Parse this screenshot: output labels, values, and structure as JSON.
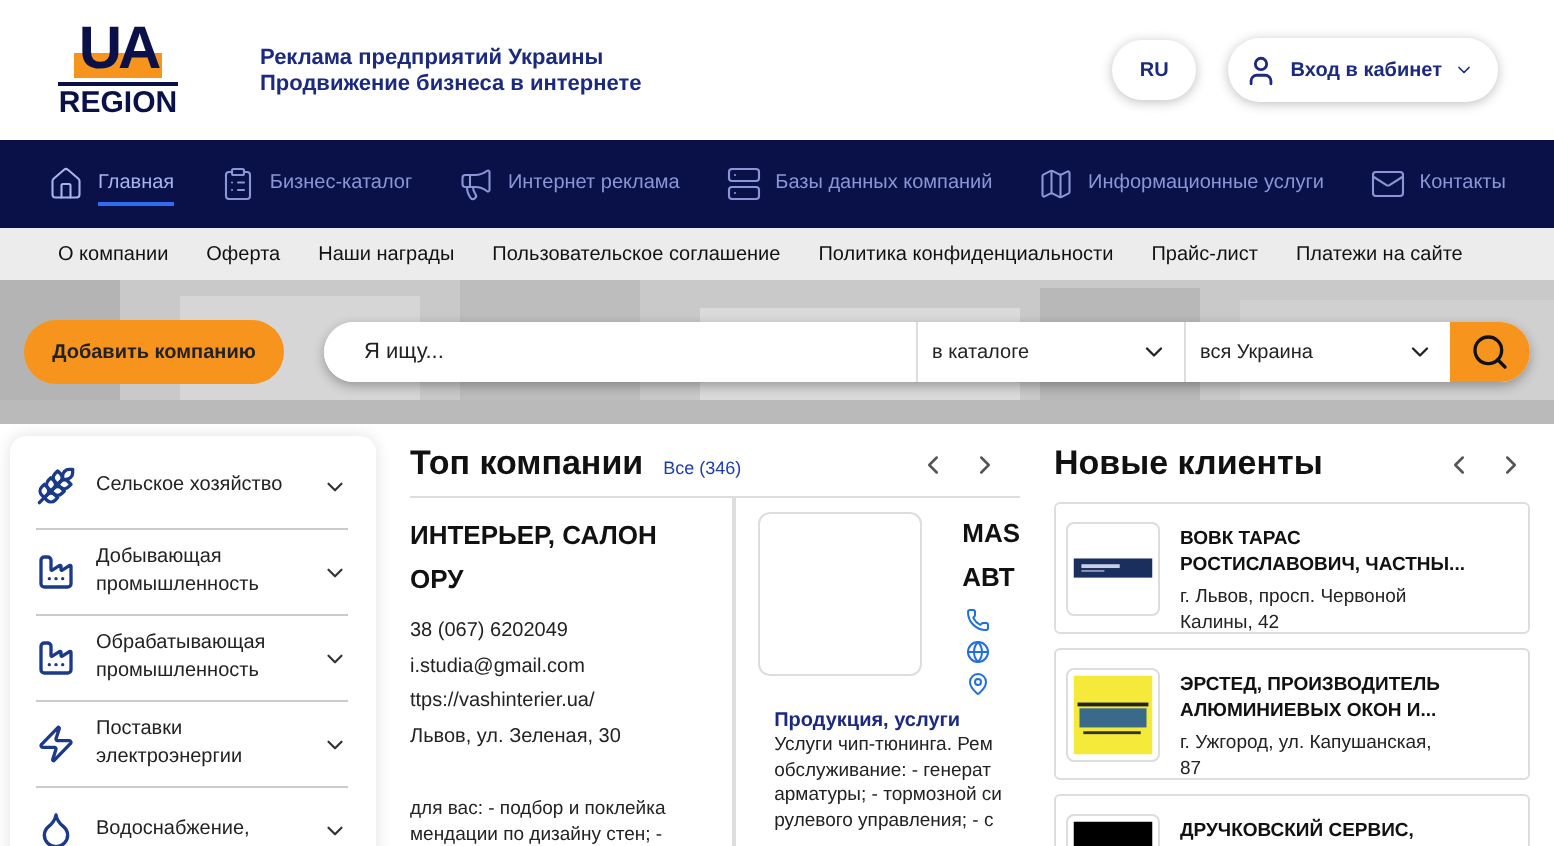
{
  "logo": {
    "top": "UA",
    "bottom": "REGION"
  },
  "tagline": [
    "Реклама предприятий Украины",
    "Продвижение бизнеса в интернете"
  ],
  "language_button": "RU",
  "login_button": "Вход в кабинет",
  "nav": [
    {
      "label": "Главная",
      "selected": true
    },
    {
      "label": "Бизнес-каталог",
      "selected": false
    },
    {
      "label": "Интернет реклама",
      "selected": false
    },
    {
      "label": "Базы данных компаний",
      "selected": false
    },
    {
      "label": "Информационные услуги",
      "selected": false
    },
    {
      "label": "Контакты",
      "selected": false
    }
  ],
  "sub_menu": [
    "О компании",
    "Оферта",
    "Наши награды",
    "Пользовательское соглашение",
    "Политика конфиденциальности",
    "Прайс-лист",
    "Платежи на сайте"
  ],
  "add_company_button": "Добавить компанию",
  "search": {
    "placeholder": "Я ищу...",
    "scope": "в каталоге",
    "region": "вся Украина"
  },
  "categories": [
    "Сельское хозяйство",
    "Добывающая промышленность",
    "Обрабатывающая промышленность",
    "Поставки электроэнергии",
    "Водоснабжение,"
  ],
  "top_companies": {
    "title": "Топ компании",
    "all_link": "Все (346)",
    "cards": [
      {
        "kind": "text",
        "title_lines": [
          "ИНТЕРЬЕР, САЛОН",
          "ОРУ"
        ],
        "contact_lines": [
          "38 (067) 6202049",
          "i.studia@gmail.com",
          "ttps://vashinterier.ua/",
          "Львов, ул. Зеленая, 30"
        ],
        "description_lines": [
          "для вас: - подбор и поклейка",
          "мендации по дизайну стен; -"
        ]
      },
      {
        "kind": "logo",
        "title_lines": [
          "MAS",
          "АВТ"
        ],
        "section_title": "Продукция, услуги",
        "description_lines": [
          "Услуги чип-тюнинга. Рем",
          "обслуживание: - генерат",
          "арматуры; - тормозной си",
          "рулевого управления; - с"
        ]
      }
    ]
  },
  "new_clients": {
    "title": "Новые клиенты",
    "cards": [
      {
        "name_lines": [
          "ВОВК ТАРАС",
          "РОСТИСЛАВОВИЧ, ЧАСТНЫ..."
        ],
        "address_lines": [
          "г. Львов, просп. Червоной",
          "Калины, 42"
        ]
      },
      {
        "name_lines": [
          "ЭРСТЕД, ПРОИЗВОДИТЕЛЬ",
          "АЛЮМИНИЕВЫХ ОКОН И..."
        ],
        "address_lines": [
          "г. Ужгород, ул. Капушанская,",
          "87"
        ]
      },
      {
        "name_lines": [
          "ДРУЧКОВСКИЙ СЕРВИС,"
        ]
      }
    ]
  }
}
